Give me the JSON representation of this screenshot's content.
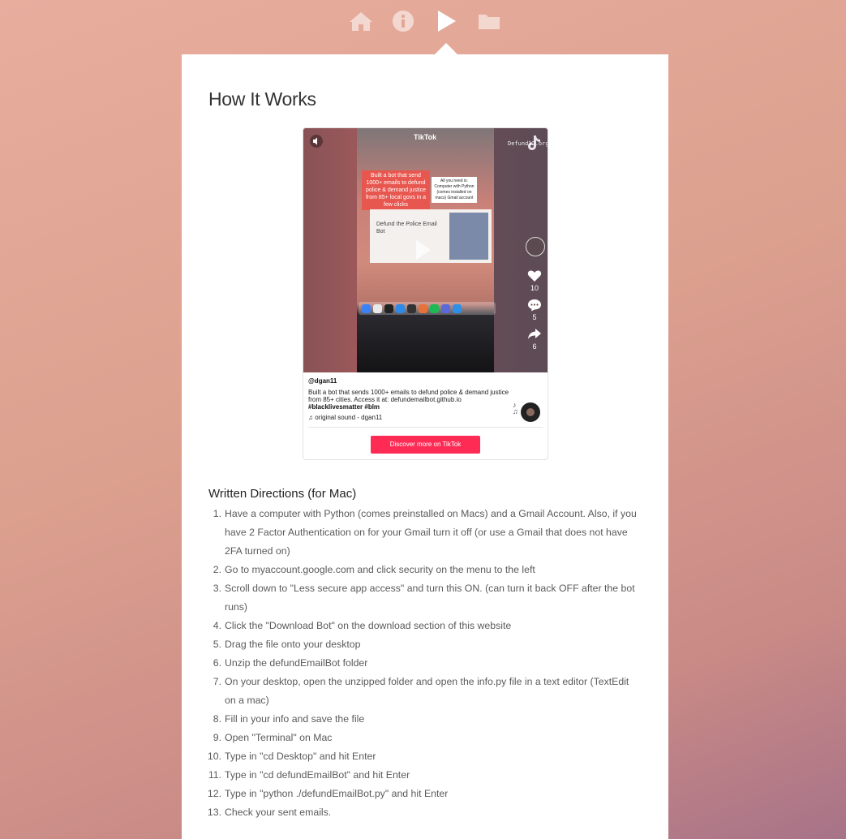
{
  "nav": {
    "items": [
      {
        "name": "home",
        "icon": "home-icon"
      },
      {
        "name": "info",
        "icon": "info-icon"
      },
      {
        "name": "video",
        "icon": "play-icon",
        "active": true
      },
      {
        "name": "download",
        "icon": "folder-icon"
      }
    ],
    "icon_color": "#ffffff"
  },
  "page": {
    "title": "How It Works"
  },
  "tiktok": {
    "logo": "TikTok",
    "url_text": "Defund12.org",
    "banner_text": "Built a bot that send 1000+ emails to defund police & demand justice from 85+ local govs in a few clicks",
    "overlay_note": "All you need is: Computer with Python (comes installed on macs) Gmail account",
    "card_title": "Defund the Police Email Bot",
    "likes": "10",
    "comments": "5",
    "shares": "6",
    "username": "@dgan11",
    "description": "Built a bot that sends 1000+ emails to defund police & demand justice from 85+ cities. Access it at: defundemailbot.github.io",
    "hashtags": "#blacklivesmatter #blm",
    "sound": "original sound - dgan11",
    "discover_label": "Discover more on TikTok",
    "accent_color": "#fe2c55"
  },
  "directions": {
    "title": "Written Directions (for Mac)",
    "steps": [
      {
        "n": "1.",
        "text": "Have a computer with Python (comes preinstalled on Macs) and a Gmail Account. Also, if you have 2 Factor Authentication on for your Gmail turn it off (or use a Gmail that does not have 2FA turned on)"
      },
      {
        "n": "2.",
        "text": "Go to myaccount.google.com and click security on the menu to the left"
      },
      {
        "n": "3.",
        "text": "Scroll down to \"Less secure app access\" and turn this ON. (can turn it back OFF after the bot runs)"
      },
      {
        "n": "4.",
        "text": "Click the \"Download Bot\" on the download section of this website"
      },
      {
        "n": "5.",
        "text": "Drag the file onto your desktop"
      },
      {
        "n": "6.",
        "text": "Unzip the defundEmailBot folder"
      },
      {
        "n": "7.",
        "text": "On your desktop, open the unzipped folder and open the info.py file in a text editor (TextEdit on a mac)"
      },
      {
        "n": "8.",
        "text": "Fill in your info and save the file"
      },
      {
        "n": "9.",
        "text": "Open \"Terminal\" on Mac"
      },
      {
        "n": "10.",
        "text": "Type in \"cd Desktop\" and hit Enter"
      },
      {
        "n": "11.",
        "text": "Type in \"cd defundEmailBot\" and hit Enter"
      },
      {
        "n": "12.",
        "text": "Type in \"python ./defundEmailBot.py\" and hit Enter"
      },
      {
        "n": "13.",
        "text": "Check your sent emails."
      }
    ]
  }
}
